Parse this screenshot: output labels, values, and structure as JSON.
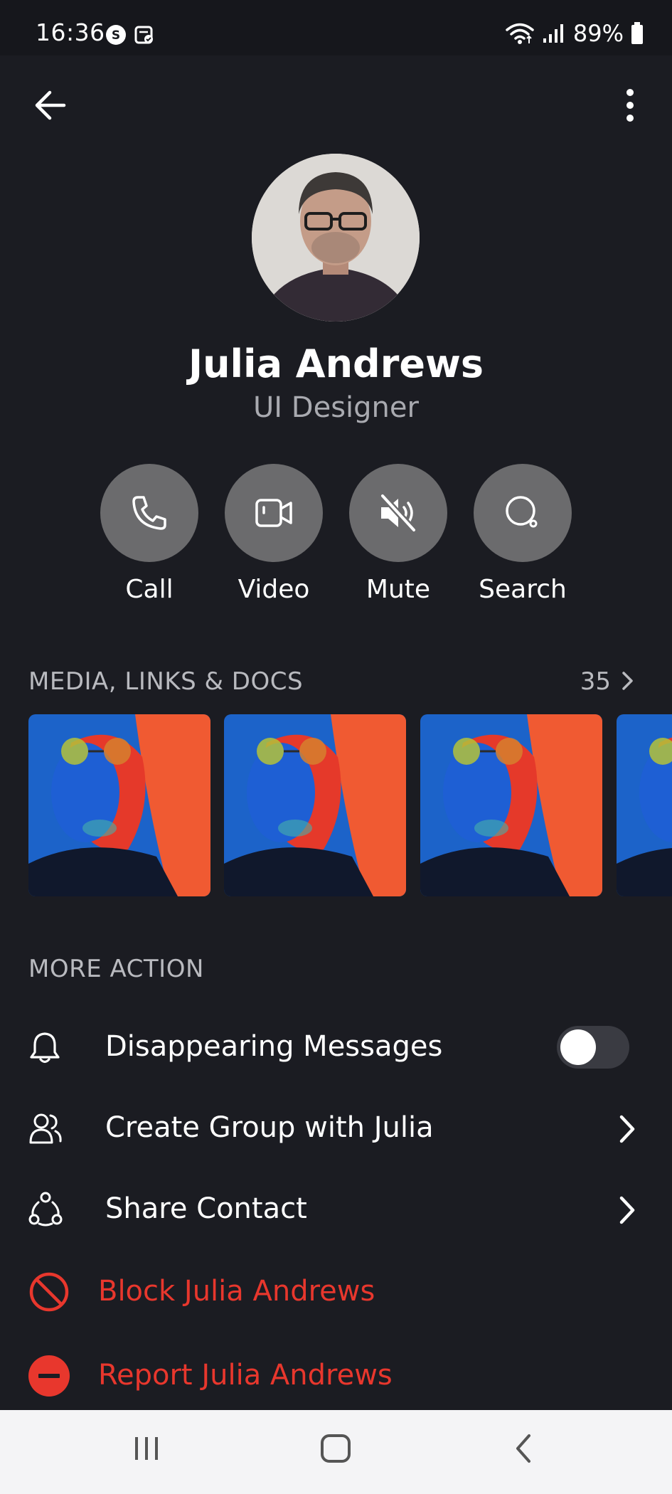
{
  "status_bar": {
    "time": "16:36",
    "battery": "89%"
  },
  "profile": {
    "name": "Julia Andrews",
    "role": "UI Designer"
  },
  "actions": [
    {
      "label": "Call",
      "icon": "phone-icon"
    },
    {
      "label": "Video",
      "icon": "video-camera-icon"
    },
    {
      "label": "Mute",
      "icon": "speaker-muted-icon"
    },
    {
      "label": "Search",
      "icon": "search-icon"
    }
  ],
  "media": {
    "title": "MEDIA, LINKS & DOCS",
    "count": "35"
  },
  "more_action": {
    "title": "MORE ACTION",
    "disappearing_label": "Disappearing Messages",
    "disappearing_on": false,
    "create_group_label": "Create Group with Julia",
    "share_contact_label": "Share Contact",
    "block_label": "Block Julia Andrews",
    "report_label": "Report Julia Andrews"
  },
  "colors": {
    "background": "#1b1c22",
    "danger": "#e8372d",
    "action_circle": "#6b6b6d"
  }
}
